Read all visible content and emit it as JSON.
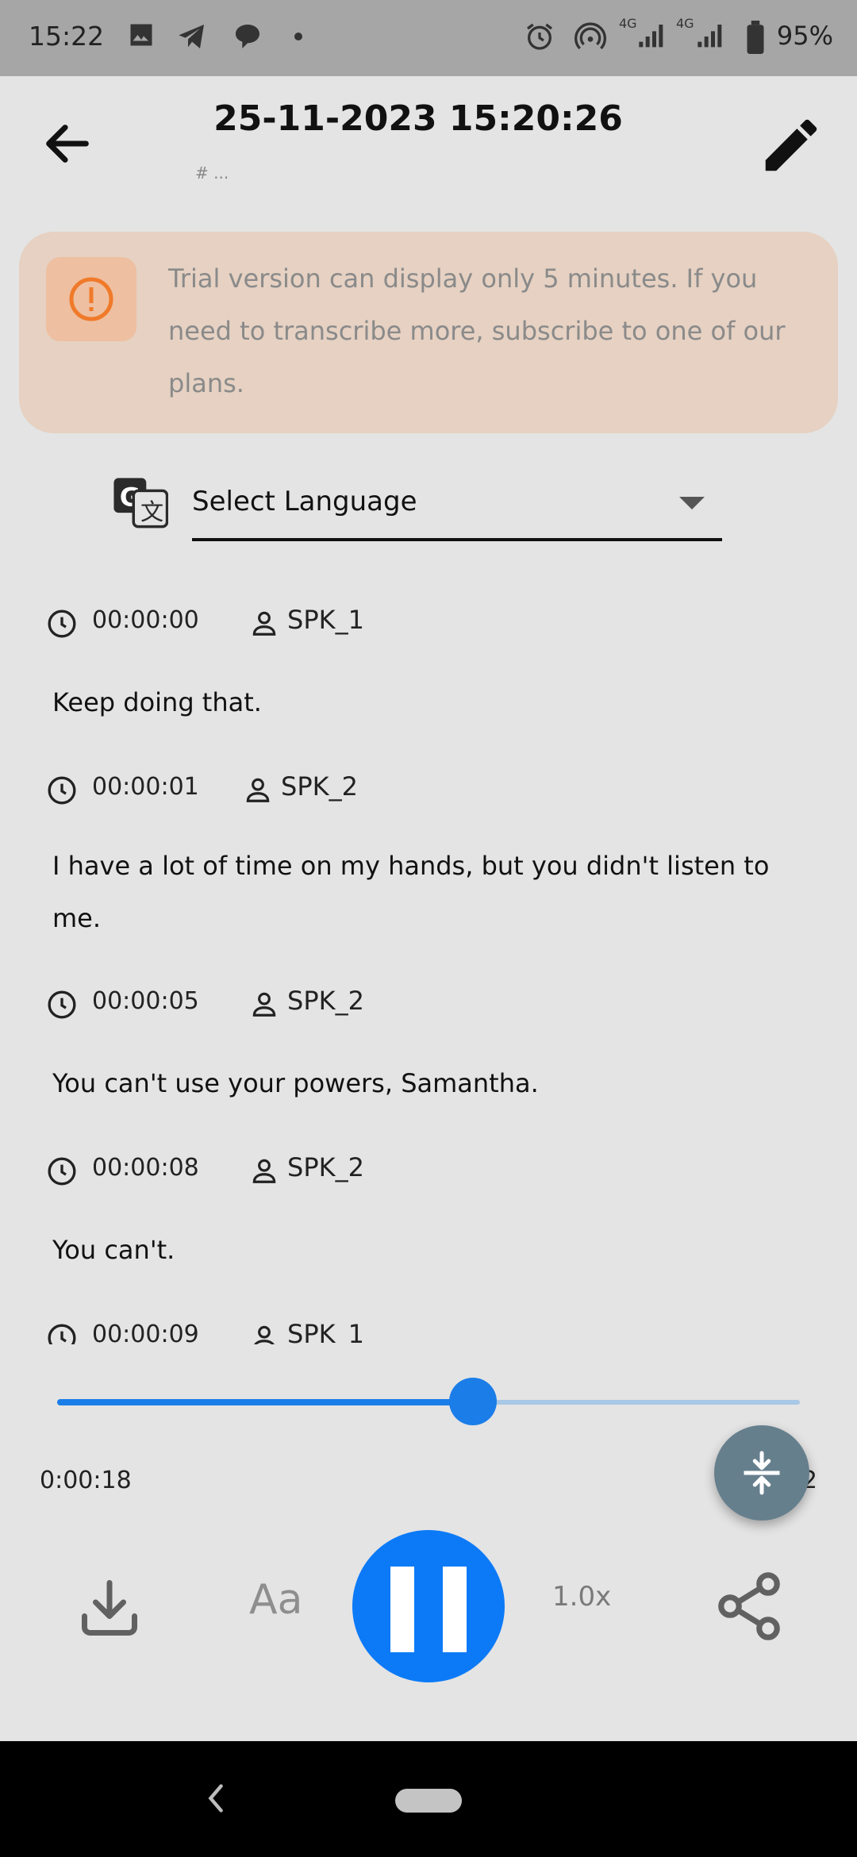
{
  "status_bar": {
    "time": "15:22",
    "network_label_1": "4G",
    "network_label_2": "4G",
    "battery_percent": "95%"
  },
  "header": {
    "title": "25-11-2023 15:20:26",
    "subtitle": "# ..."
  },
  "trial_banner": {
    "text": "Trial version can display only 5 minutes. If you need to transcribe more, subscribe to one of our plans.",
    "accent_color": "#f07a2a"
  },
  "language_selector": {
    "label": "Select Language"
  },
  "transcript": [
    {
      "time": "00:00:00",
      "speaker": "SPK_1",
      "text": "Keep doing that."
    },
    {
      "time": "00:00:01",
      "speaker": "SPK_2",
      "text": "I have a lot of time on my hands, but you didn't listen to me."
    },
    {
      "time": "00:00:05",
      "speaker": "SPK_2",
      "text": "You can't use your powers, Samantha."
    },
    {
      "time": "00:00:08",
      "speaker": "SPK_2",
      "text": "You can't."
    },
    {
      "time": "00:00:09",
      "speaker": "SPK_1",
      "text": ""
    }
  ],
  "player": {
    "current_time": "0:00:18",
    "total_time_visible": "2",
    "progress": 0.56,
    "speed": "1.0x",
    "accent_color": "#0c7af7"
  },
  "controls": {
    "download_icon": "download-icon",
    "font_icon": "font-size-icon",
    "font_glyph": "Aa",
    "play_state_icon": "pause-icon",
    "share_icon": "share-icon"
  }
}
